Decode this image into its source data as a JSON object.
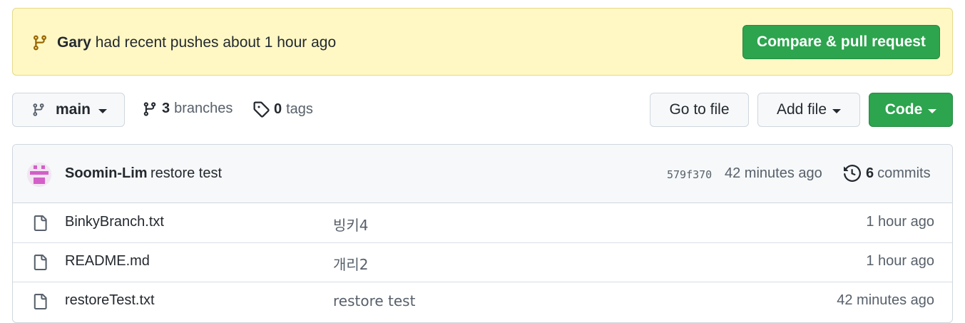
{
  "banner": {
    "user": "Gary",
    "message": "had recent pushes about 1 hour ago",
    "button_label": "Compare & pull request"
  },
  "toolbar": {
    "branch_label": "main",
    "branches_count": "3",
    "branches_label": "branches",
    "tags_count": "0",
    "tags_label": "tags",
    "go_to_file_label": "Go to file",
    "add_file_label": "Add file",
    "code_label": "Code"
  },
  "latest_commit": {
    "author": "Soomin-Lim",
    "message": "restore test",
    "sha": "579f370",
    "time": "42 minutes ago",
    "commits_count": "6",
    "commits_label": "commits"
  },
  "files": [
    {
      "name": "BinkyBranch.txt",
      "message": "빙키4",
      "time": "1 hour ago"
    },
    {
      "name": "README.md",
      "message": "개리2",
      "time": "1 hour ago"
    },
    {
      "name": "restoreTest.txt",
      "message": "restore test",
      "time": "42 minutes ago"
    }
  ],
  "colors": {
    "banner_bg": "#fff8c5",
    "primary_green": "#2da44e",
    "muted_text": "#57606a",
    "branch_icon_color": "#9a6700",
    "avatar_pink": "#d35fc8"
  },
  "icons": {
    "banner": "git-branch-icon",
    "branch_button": "git-branch-icon",
    "branches": "git-branch-icon",
    "tags": "tag-icon",
    "history": "history-icon",
    "file": "file-icon"
  }
}
